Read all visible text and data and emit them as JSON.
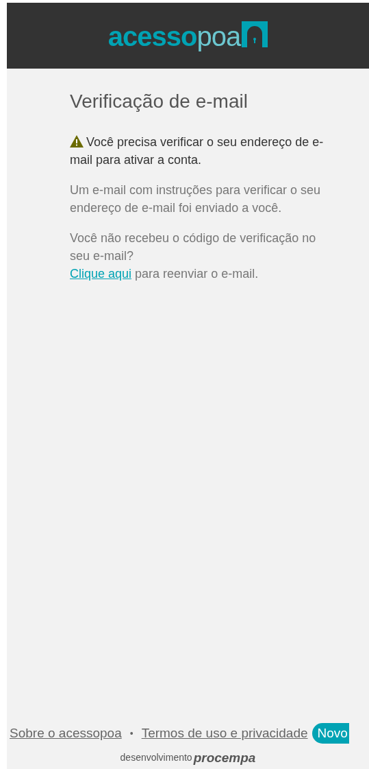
{
  "header": {
    "logo": {
      "bold": "acesso",
      "light": "poa"
    }
  },
  "title": "Verificação de e-mail",
  "alert": {
    "kind": "warning",
    "text": "Você precisa verificar o seu endereço de e-mail para ativar a conta."
  },
  "info": "Um e-mail com instruções para verificar o seu endereço de e-mail foi enviado a você.",
  "resend": {
    "question": "Você não recebeu o código de verificação no seu e-mail?",
    "link": "Clique aqui",
    "rest": "para reenviar o e-mail."
  },
  "footer": {
    "links": [
      "Sobre o acessopoa",
      "Termos de uso e privacidade"
    ],
    "separator": "•",
    "badge": "Novo",
    "credit": {
      "label": "desenvolvimento",
      "brand": "procempa"
    }
  }
}
